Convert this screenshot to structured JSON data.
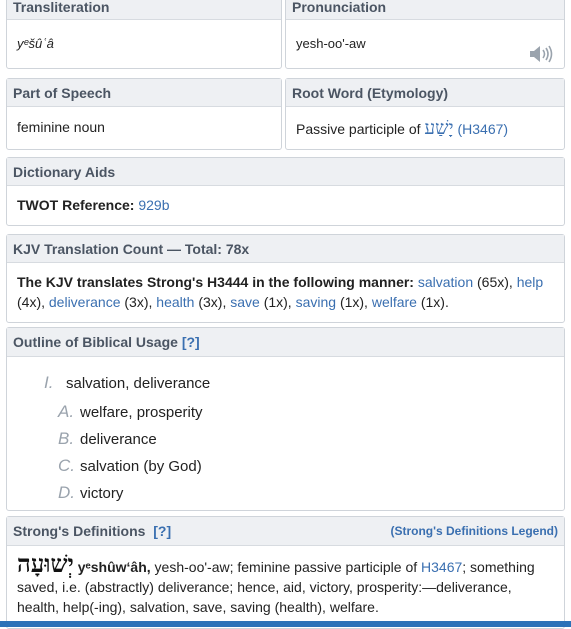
{
  "transliteration": {
    "header": "Transliteration",
    "value": "yᵉšûʿâ"
  },
  "pronunciation": {
    "header": "Pronunciation",
    "value": "yesh-oo'-aw",
    "icon": "speaker-icon"
  },
  "part_of_speech": {
    "header": "Part of Speech",
    "value": "feminine noun"
  },
  "root_word": {
    "header": "Root Word (Etymology)",
    "prefix": "Passive participle of",
    "hebrew": "יָשַׁע",
    "ref": "(H3467)"
  },
  "dictionary_aids": {
    "header": "Dictionary Aids",
    "twot_label": "TWOT Reference:",
    "twot_value": "929b"
  },
  "kjv": {
    "header": "KJV Translation Count — Total: 78x",
    "intro": "The KJV translates Strong's H3444 in the following manner:",
    "items": [
      {
        "word": "salvation",
        "count": "(65x),"
      },
      {
        "word": "help",
        "count": "(4x),"
      },
      {
        "word": "deliverance",
        "count": "(3x),"
      },
      {
        "word": "health",
        "count": "(3x),"
      },
      {
        "word": "save",
        "count": "(1x),"
      },
      {
        "word": "saving",
        "count": "(1x),"
      },
      {
        "word": "welfare",
        "count": "(1x)."
      }
    ]
  },
  "outline": {
    "header": "Outline of Biblical Usage",
    "help": "[?]",
    "items": [
      {
        "mark": "I.",
        "text": "salvation, deliverance"
      },
      {
        "mark": "A.",
        "text": "welfare, prosperity"
      },
      {
        "mark": "B.",
        "text": "deliverance"
      },
      {
        "mark": "C.",
        "text": "salvation (by God)"
      },
      {
        "mark": "D.",
        "text": "victory"
      }
    ]
  },
  "strongs": {
    "header": "Strong's Definitions",
    "help": "[?]",
    "legend": "(Strong's Definitions Legend)",
    "hebrew": "יְשׁוּעָה",
    "translit": "yᵉshûwʻâh,",
    "text1": "yesh-oo'-aw; feminine passive participle of",
    "ref": "H3467",
    "text2": "; something saved, i.e. (abstractly) deliverance; hence, aid, victory, prosperity:—deliverance, health, help(-ing), salvation, save, saving (health), welfare."
  }
}
